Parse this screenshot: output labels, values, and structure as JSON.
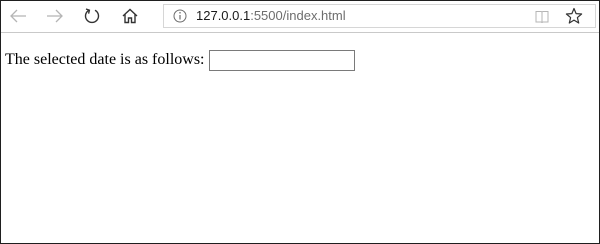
{
  "browser": {
    "toolbar": {
      "back_icon": "back-arrow-icon",
      "forward_icon": "forward-arrow-icon",
      "reload_icon": "refresh-icon",
      "home_icon": "home-icon"
    },
    "address_bar": {
      "info_icon": "info-icon",
      "url_host": "127.0.0.1",
      "url_rest": ":5500/index.html",
      "reading_view_icon": "reading-view-icon",
      "favorite_icon": "star-icon"
    }
  },
  "page": {
    "label": "The selected date is as follows:",
    "date_input": {
      "value": "",
      "placeholder": ""
    }
  },
  "colors": {
    "icon_gray": "#b5b5b5",
    "icon_dark": "#333333",
    "url_host": "#1a1a1a",
    "url_rest": "#6d6d6d",
    "border": "#1f1f1f"
  }
}
